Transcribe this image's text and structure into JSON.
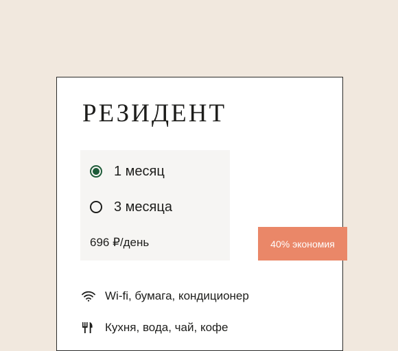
{
  "plan": {
    "title": "РЕЗИДЕНТ",
    "options": [
      {
        "label": "1 месяц",
        "selected": true
      },
      {
        "label": "3 месяца",
        "selected": false
      }
    ],
    "price": "696 ₽/день",
    "discount_badge": "40% экономия",
    "features": [
      {
        "icon": "wifi-icon",
        "label": "Wi-fi, бумага, кондиционер"
      },
      {
        "icon": "cutlery-icon",
        "label": "Кухня, вода, чай, кофе"
      }
    ]
  },
  "colors": {
    "background": "#f1e8de",
    "card": "#ffffff",
    "accent_green": "#1c5a37",
    "badge": "#ea8768"
  }
}
